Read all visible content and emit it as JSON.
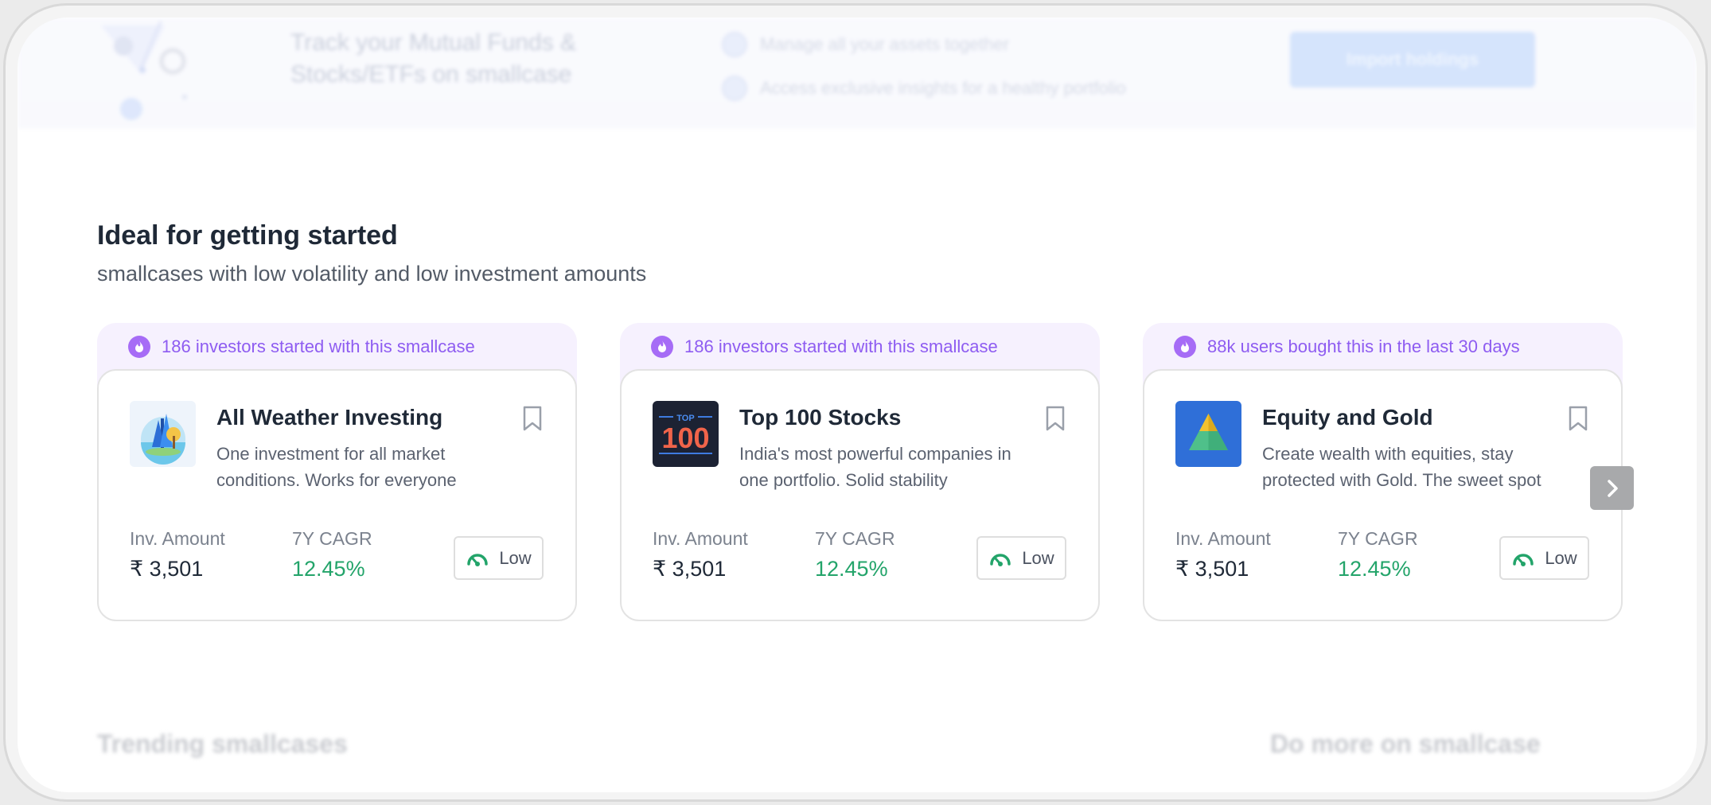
{
  "banner": {
    "title": "Track your Mutual Funds & Stocks/ETFs on smallcase",
    "points": [
      "Manage all your assets together",
      "Access exclusive insights for a healthy portfolio"
    ],
    "button_label": "Import holdings"
  },
  "section": {
    "title": "Ideal for getting started",
    "subtitle": "smallcases with low volatility and low investment amounts"
  },
  "cards": [
    {
      "ribbon": "186 investors started with this smallcase",
      "name": "All Weather Investing",
      "description": "One investment for all market conditions. Works for everyone",
      "inv_label": "Inv. Amount",
      "inv_value": "₹ 3,501",
      "cagr_label": "7Y CAGR",
      "cagr_value": "12.45%",
      "volatility": "Low",
      "logo": "all-weather-logo"
    },
    {
      "ribbon": "186 investors started with this smallcase",
      "name": "Top 100 Stocks",
      "description": "India's most powerful companies in one portfolio. Solid stability",
      "inv_label": "Inv. Amount",
      "inv_value": "₹ 3,501",
      "cagr_label": "7Y CAGR",
      "cagr_value": "12.45%",
      "volatility": "Low",
      "logo": "top-100-logo",
      "logo_text_small": "TOP",
      "logo_text_big": "100"
    },
    {
      "ribbon": "88k users bought this in the last 30 days",
      "name": "Equity and Gold",
      "description": "Create wealth with equities, stay protected with Gold. The sweet spot",
      "inv_label": "Inv. Amount",
      "inv_value": "₹ 3,501",
      "cagr_label": "7Y CAGR",
      "cagr_value": "12.45%",
      "volatility": "Low",
      "logo": "equity-gold-logo"
    }
  ],
  "bottom": {
    "left_heading": "Trending smallcases",
    "right_heading": "Do more on smallcase"
  },
  "colors": {
    "accent_purple": "#8e5cf1",
    "green": "#23a46a",
    "banner_button": "#c7dbfb"
  }
}
